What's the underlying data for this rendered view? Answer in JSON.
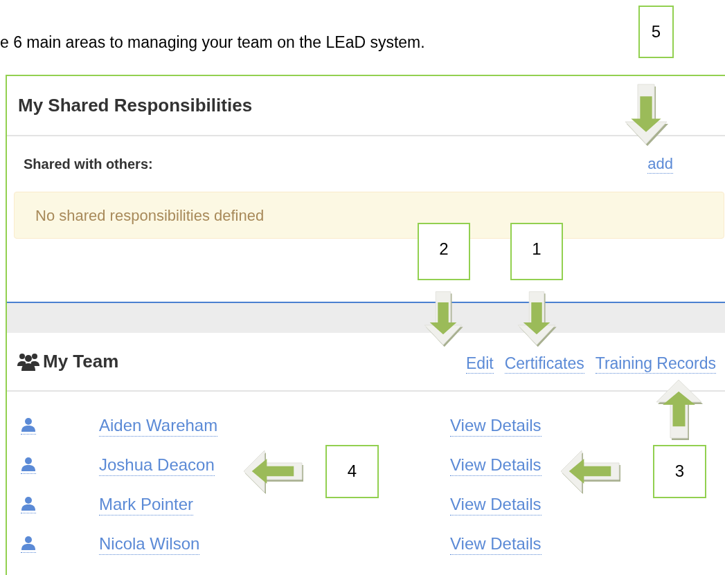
{
  "intro": "e 6 main areas to managing your team on the LEaD system.",
  "shared_panel": {
    "title": "My Shared Responsibilities",
    "subheading": "Shared with others:",
    "add_link": "add",
    "alert": "No shared responsibilities defined"
  },
  "team_panel": {
    "title": "My Team",
    "actions": [
      "Edit",
      "Certificates",
      "Training Records"
    ],
    "members": [
      {
        "name": "Aiden Wareham",
        "link": "View Details"
      },
      {
        "name": "Joshua Deacon",
        "link": "View Details"
      },
      {
        "name": "Mark Pointer",
        "link": "View Details"
      },
      {
        "name": "Nicola Wilson",
        "link": "View Details"
      }
    ]
  },
  "callouts": [
    {
      "label": "5"
    },
    {
      "label": "2"
    },
    {
      "label": "1"
    },
    {
      "label": "4"
    },
    {
      "label": "3"
    }
  ]
}
